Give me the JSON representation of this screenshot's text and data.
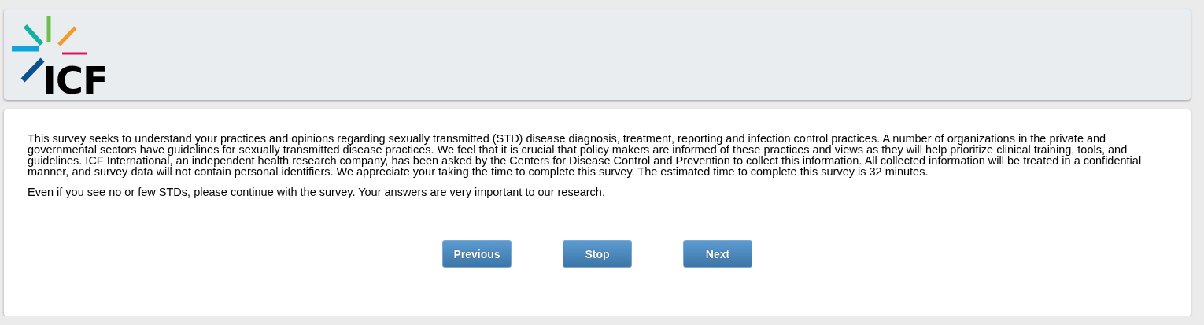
{
  "header": {
    "logo": {
      "text": "ICF"
    }
  },
  "intro": {
    "paragraphs": [
      "This survey seeks to understand your practices and opinions regarding sexually transmitted (STD) disease diagnosis, treatment, reporting and infection control practices. A number of organizations in the private and governmental sectors have guidelines for sexually transmitted disease practices. We feel that it is crucial that policy makers are informed of these practices and views as they will help prioritize clinical training, tools, and guidelines. ICF International, an independent health research company, has been asked by the Centers for Disease Control and Prevention to collect this information. All collected information will be treated in a confidential manner, and survey data will not contain personal identifiers. We appreciate your taking the time to complete this survey. The estimated time to complete this survey is 32 minutes.",
      "Even if you see no or few STDs, please continue with the survey. Your answers are very important to our research."
    ]
  },
  "buttons": [
    {
      "label": "Previous"
    },
    {
      "label": "Stop"
    },
    {
      "label": "Next"
    }
  ]
}
